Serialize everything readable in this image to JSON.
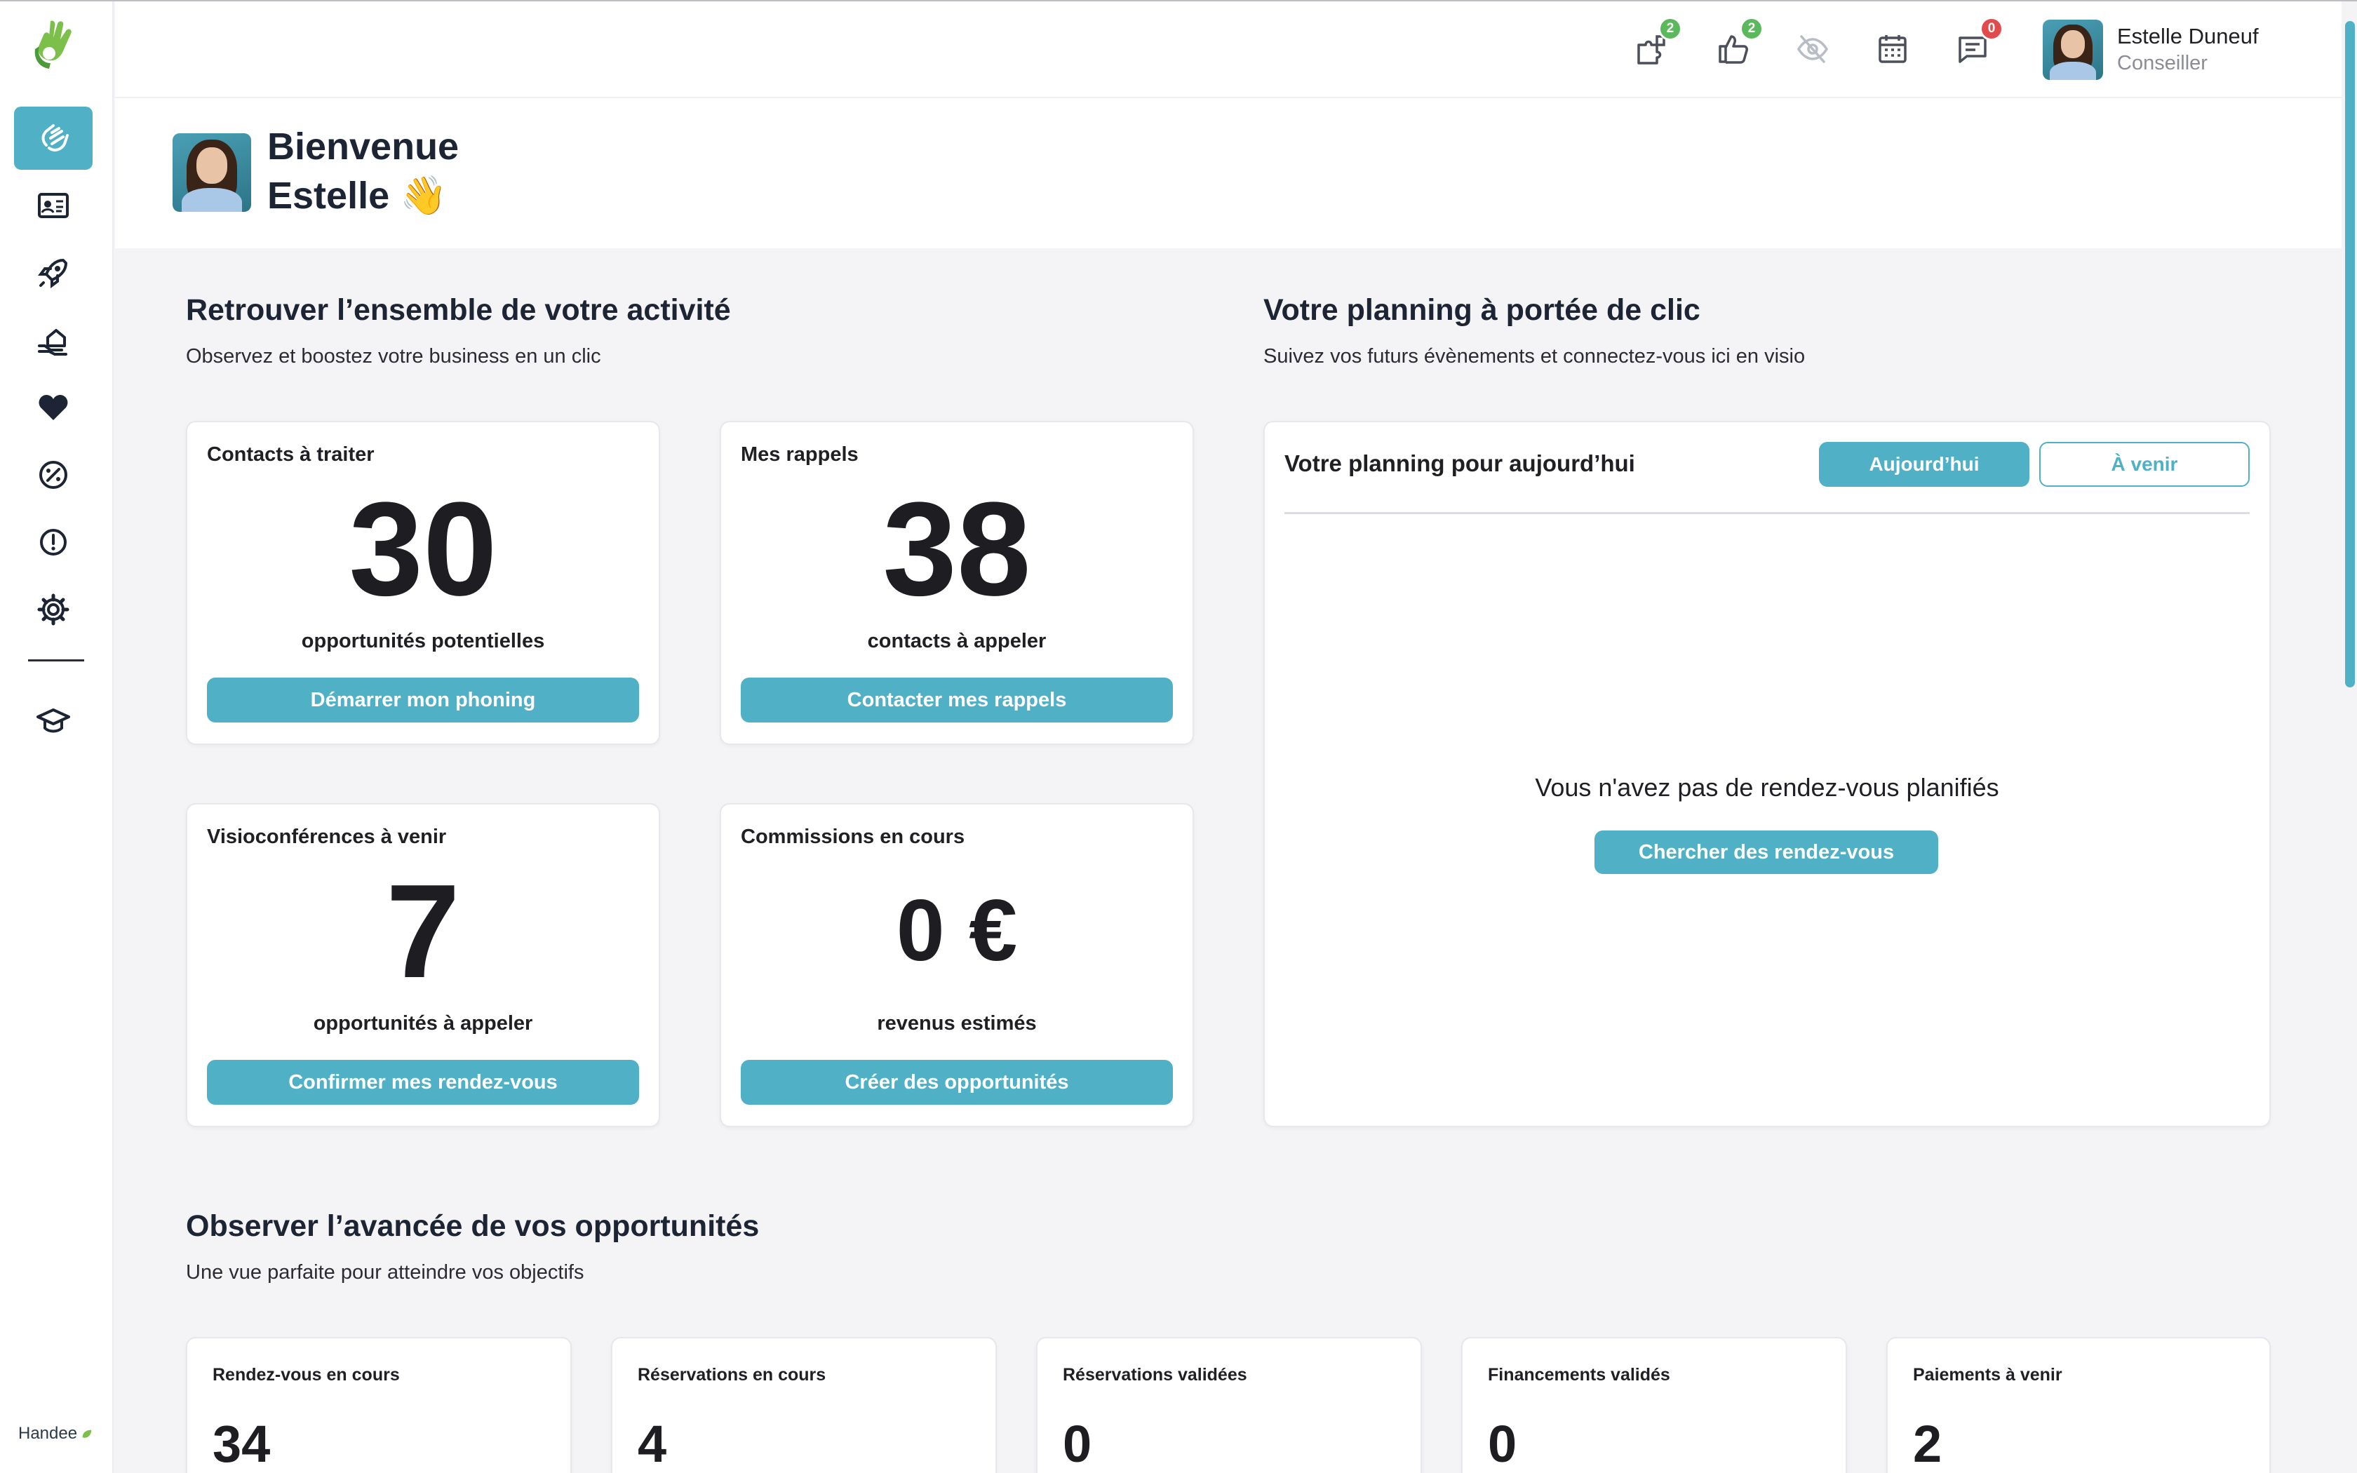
{
  "header": {
    "badges": {
      "missions": "2",
      "likes": "2",
      "messages": "0"
    },
    "user": {
      "name": "Estelle Duneuf",
      "role": "Conseiller"
    }
  },
  "sidebar": {
    "brand": "Handee"
  },
  "welcome": {
    "line1": "Bienvenue",
    "line2": "Estelle 👋"
  },
  "activity": {
    "title": "Retrouver l’ensemble de votre activité",
    "subtitle": "Observez et boostez votre business en un clic",
    "cards": [
      {
        "label": "Contacts à traiter",
        "value": "30",
        "caption": "opportunités potentielles",
        "button": "Démarrer mon phoning"
      },
      {
        "label": "Mes rappels",
        "value": "38",
        "caption": "contacts à appeler",
        "button": "Contacter mes rappels"
      },
      {
        "label": "Visioconférences à venir",
        "value": "7",
        "caption": "opportunités à appeler",
        "button": "Confirmer mes rendez-vous"
      },
      {
        "label": "Commissions en cours",
        "value": "0 €",
        "caption": "revenus estimés",
        "button": "Créer des opportunités"
      }
    ]
  },
  "planning": {
    "title": "Votre planning à portée de clic",
    "subtitle": "Suivez vos futurs évènements et connectez-vous ici en visio",
    "panel_title": "Votre planning pour aujourd’hui",
    "tab_today": "Aujourd’hui",
    "tab_future": "À venir",
    "empty": "Vous n'avez pas de rendez-vous planifiés",
    "button": "Chercher des rendez-vous"
  },
  "progress": {
    "title": "Observer l’avancée de vos opportunités",
    "subtitle": "Une vue parfaite pour atteindre vos objectifs",
    "stats": [
      {
        "label": "Rendez-vous en cours",
        "value": "34"
      },
      {
        "label": "Réservations en cours",
        "value": "4"
      },
      {
        "label": "Réservations validées",
        "value": "0"
      },
      {
        "label": "Financements validés",
        "value": "0"
      },
      {
        "label": "Paiements à venir",
        "value": "2"
      }
    ]
  },
  "colors": {
    "accent": "#4fb0c6",
    "badge_green": "#5cb85c",
    "badge_red": "#e24b4b"
  }
}
